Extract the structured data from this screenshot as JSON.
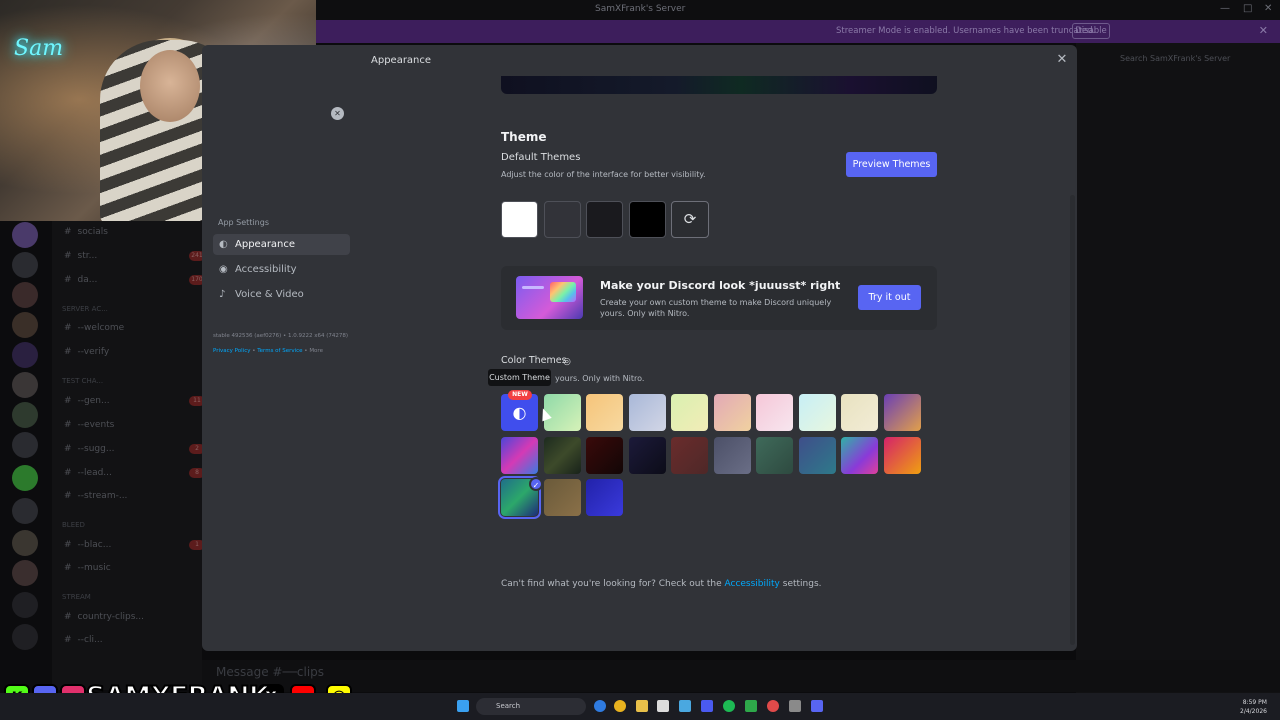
{
  "window": {
    "title": "SamXFrank's Server",
    "controls": [
      "—",
      "□",
      "✕"
    ]
  },
  "streamer_banner": {
    "message": "Streamer Mode is enabled. Usernames have been truncated.",
    "disable_label": "Disable"
  },
  "right_panel": {
    "search_placeholder": "Search SamXFrank's Server"
  },
  "background_channels": [
    {
      "name": "socials"
    },
    {
      "name": "str...",
      "count": "241"
    },
    {
      "name": "da...",
      "count": "170"
    },
    {
      "category": "SERVER AC..."
    },
    {
      "name": "--welcome"
    },
    {
      "name": "--verify"
    },
    {
      "category": "Test Cha..."
    },
    {
      "name": "--gen...",
      "count": "11"
    },
    {
      "name": "--events"
    },
    {
      "name": "--sugg...",
      "count": "2"
    },
    {
      "name": "--lead...",
      "count": "8"
    },
    {
      "name": "--stream-..."
    },
    {
      "category": "Bleed"
    },
    {
      "name": "--blac...",
      "count": "1"
    },
    {
      "name": "--music"
    },
    {
      "category": "stream"
    },
    {
      "name": "country-clips..."
    },
    {
      "name": "--cli..."
    }
  ],
  "message_bar": {
    "placeholder": "Message #──clips"
  },
  "modal": {
    "title": "Appearance",
    "sidebar": {
      "heading": "App Settings",
      "items": [
        {
          "label": "Appearance",
          "icon": "palette-icon",
          "selected": true
        },
        {
          "label": "Accessibility",
          "icon": "accessibility-icon",
          "selected": false
        },
        {
          "label": "Voice & Video",
          "icon": "microphone-icon",
          "selected": false
        }
      ],
      "build_info": "stable 492536 (aef0276) • 1.0.9222 x64 (74278)",
      "legal": {
        "privacy": "Privacy Policy",
        "sep1": " • ",
        "terms": "Terms of Service",
        "sep2": " • ",
        "more": "More"
      }
    },
    "theme": {
      "section_title": "Theme",
      "default_heading": "Default Themes",
      "default_sub": "Adjust the color of the interface for better visibility.",
      "preview_button": "Preview Themes",
      "default_swatches": [
        {
          "name": "light",
          "color": "#ffffff"
        },
        {
          "name": "ash",
          "color": "#323339"
        },
        {
          "name": "dark",
          "color": "#1a1a1e"
        },
        {
          "name": "onyx",
          "color": "#000000"
        }
      ],
      "sync_icon": "sync-icon"
    },
    "nitro": {
      "title": "Make your Discord look *juuusst* right",
      "subtitle": "Create your own custom theme to make Discord uniquely yours. Only with Nitro.",
      "button": "Try it out"
    },
    "color_themes": {
      "heading": "Color Themes",
      "subtitle": "yours. Only with Nitro.",
      "tooltip": "Custom Theme",
      "new_badge": "NEW",
      "custom_icon": "palette-icon",
      "selected_index": 20,
      "swatches": [
        "custom",
        "linear-gradient(135deg,#8fd9a8,#d6f2b8)",
        "linear-gradient(135deg,#f6c47a,#f7d9a0)",
        "linear-gradient(135deg,#a9b8d8,#d2d6e6)",
        "linear-gradient(135deg,#d9f0b0,#f2ecb7)",
        "linear-gradient(135deg,#e2a9b6,#f0d1a0)",
        "linear-gradient(135deg,#f6c7d8,#f7e6ef)",
        "linear-gradient(135deg,#c7eff6,#e8f7df)",
        "linear-gradient(135deg,#e8e2c0,#f2ecd6)",
        "linear-gradient(135deg,#6a3fb5,#e2a04a)",
        "linear-gradient(135deg,#4a46d9,#d43ab5 50%,#3a7be0)",
        "linear-gradient(135deg,#1d2b1f,#3d4a2a 50%,#18221a)",
        "linear-gradient(135deg,#3a0a0a,#120606)",
        "linear-gradient(135deg,#1c1a3a,#0c0c18)",
        "linear-gradient(135deg,#6a2c2c,#4e2828)",
        "linear-gradient(135deg,#4c5068,#6a6e86)",
        "linear-gradient(135deg,#3f6a5a,#2e4a40)",
        "linear-gradient(135deg,#3f4e8a,#2e7a8a)",
        "linear-gradient(135deg,#2fb3a6,#8a3ad8 60%,#e0409a)",
        "linear-gradient(135deg,#d4226a,#f0a010)",
        "linear-gradient(135deg,#1f6e8a,#2ca86a 50%,#1e2a7a)",
        "linear-gradient(135deg,#6a5a3a,#8a7048)",
        "linear-gradient(135deg,#2222aa,#3a3adc)"
      ]
    },
    "footer": {
      "prefix": "Can't find what you're looking for? Check out the ",
      "link": "Accessibility",
      "suffix": " settings."
    }
  },
  "webcam": {
    "neon_sign": "Sam"
  },
  "social_overlay": {
    "handle": "SAMXFRANK",
    "icons": [
      {
        "name": "kick-icon",
        "glyph": "K",
        "bg": "#53fc18",
        "fg": "#000"
      },
      {
        "name": "discord-icon",
        "glyph": "◉",
        "bg": "#5865f2",
        "fg": "#fff"
      },
      {
        "name": "instagram-icon",
        "glyph": "◎",
        "bg": "#e1306c",
        "fg": "#fff"
      },
      {
        "name": "x-icon",
        "glyph": "X",
        "bg": "#000",
        "fg": "#fff"
      },
      {
        "name": "youtube-icon",
        "glyph": "▶",
        "bg": "#ff0000",
        "fg": "#fff"
      },
      {
        "name": "snapchat-icon",
        "glyph": "☺",
        "bg": "#fffc00",
        "fg": "#000"
      }
    ]
  },
  "taskbar": {
    "search_label": "Search",
    "time": "8:59 PM",
    "date": "2/4/2026"
  }
}
